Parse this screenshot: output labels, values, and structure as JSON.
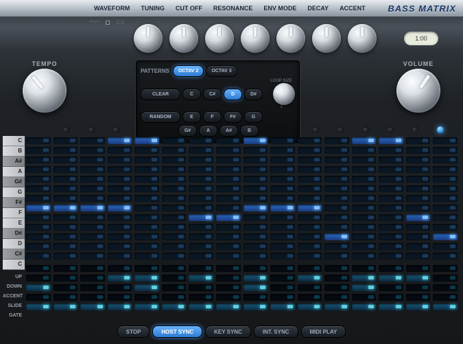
{
  "header": {
    "items": [
      "WAVEFORM",
      "TUNING",
      "CUT OFF",
      "RESONANCE",
      "ENV MODE",
      "DECAY",
      "ACCENT"
    ],
    "logo": "BASS MATRIX"
  },
  "lcd": "1:00",
  "tempo_label": "TEMPO",
  "volume_label": "VOLUME",
  "patterns": {
    "label": "PATTERNS",
    "octave_tabs": [
      "OCTAV 2",
      "OCTAV 3"
    ],
    "clear": "CLEAR",
    "random": "RANDOM",
    "notes_row1": [
      "C",
      "C#",
      "D",
      "D#"
    ],
    "notes_row2": [
      "E",
      "F",
      "F#",
      "G"
    ],
    "notes_row3": [
      "G#",
      "A",
      "A#",
      "B"
    ],
    "loop_label": "LOOP SIZE",
    "loop_value": "1",
    "active_octave": 0,
    "active_note": 2
  },
  "step_count": 16,
  "active_step": 15,
  "note_rows": [
    "C",
    "B",
    "A#",
    "A",
    "G#",
    "G",
    "F#",
    "F",
    "E",
    "D#",
    "D",
    "C#",
    "C"
  ],
  "note_black": [
    false,
    false,
    true,
    false,
    true,
    false,
    true,
    false,
    false,
    true,
    false,
    true,
    false
  ],
  "param_rows": [
    "UP",
    "DOWN",
    "ACCENT",
    "SLIDE",
    "GATE"
  ],
  "grid": {
    "notes": {
      "0": [
        0,
        0,
        0,
        1,
        1,
        0,
        0,
        0,
        1,
        0,
        0,
        0,
        1,
        1,
        0,
        0
      ],
      "7": [
        1,
        1,
        1,
        1,
        0,
        0,
        0,
        0,
        1,
        1,
        1,
        0,
        0,
        0,
        0,
        0
      ],
      "8": [
        0,
        0,
        0,
        0,
        0,
        0,
        1,
        1,
        0,
        0,
        0,
        0,
        0,
        0,
        1,
        0
      ],
      "10": [
        0,
        0,
        0,
        0,
        0,
        0,
        0,
        0,
        0,
        0,
        0,
        1,
        0,
        0,
        0,
        1
      ]
    },
    "params": {
      "0": [
        0,
        0,
        0,
        0,
        0,
        0,
        0,
        0,
        0,
        0,
        0,
        0,
        0,
        0,
        0,
        0
      ],
      "1": [
        0,
        0,
        0,
        1,
        1,
        0,
        1,
        0,
        1,
        0,
        1,
        0,
        1,
        1,
        1,
        0
      ],
      "2": [
        1,
        0,
        0,
        0,
        1,
        0,
        0,
        0,
        1,
        0,
        0,
        0,
        1,
        0,
        0,
        0
      ],
      "3": [
        0,
        0,
        0,
        0,
        0,
        0,
        0,
        0,
        0,
        0,
        0,
        0,
        0,
        0,
        0,
        0
      ],
      "4": [
        1,
        1,
        1,
        1,
        1,
        1,
        1,
        1,
        1,
        1,
        1,
        1,
        1,
        1,
        1,
        1
      ]
    }
  },
  "transport": [
    "STOP",
    "HOST SYNC",
    "KEY SYNC",
    "INT. SYNC",
    "MIDI PLAY"
  ],
  "transport_active": 1
}
